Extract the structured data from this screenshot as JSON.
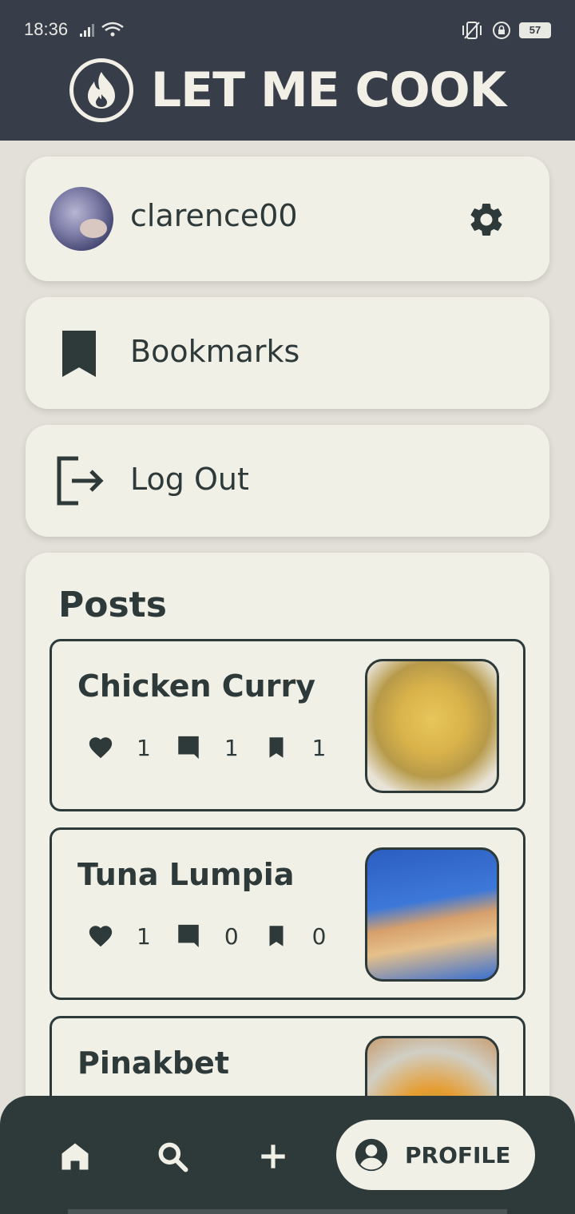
{
  "status_bar": {
    "time": "18:36",
    "battery": "57"
  },
  "header": {
    "title": "LET ME COOK",
    "logo_icon": "flame-icon"
  },
  "profile": {
    "username": "clarence00",
    "settings_icon": "gear-icon"
  },
  "menu": {
    "bookmarks_label": "Bookmarks",
    "logout_label": "Log Out"
  },
  "posts": {
    "title": "Posts",
    "items": [
      {
        "title": "Chicken Curry",
        "likes": "1",
        "comments": "1",
        "bookmarks": "1"
      },
      {
        "title": "Tuna Lumpia",
        "likes": "1",
        "comments": "0",
        "bookmarks": "0"
      },
      {
        "title": "Pinakbet"
      }
    ]
  },
  "bottom_nav": {
    "items": [
      "home-icon",
      "search-icon",
      "add-icon"
    ],
    "active_label": "PROFILE"
  },
  "colors": {
    "header_bg": "#373d49",
    "card_bg": "#f1f0e7",
    "text": "#2e3a3a",
    "nav_bg": "#2e3a3a"
  }
}
